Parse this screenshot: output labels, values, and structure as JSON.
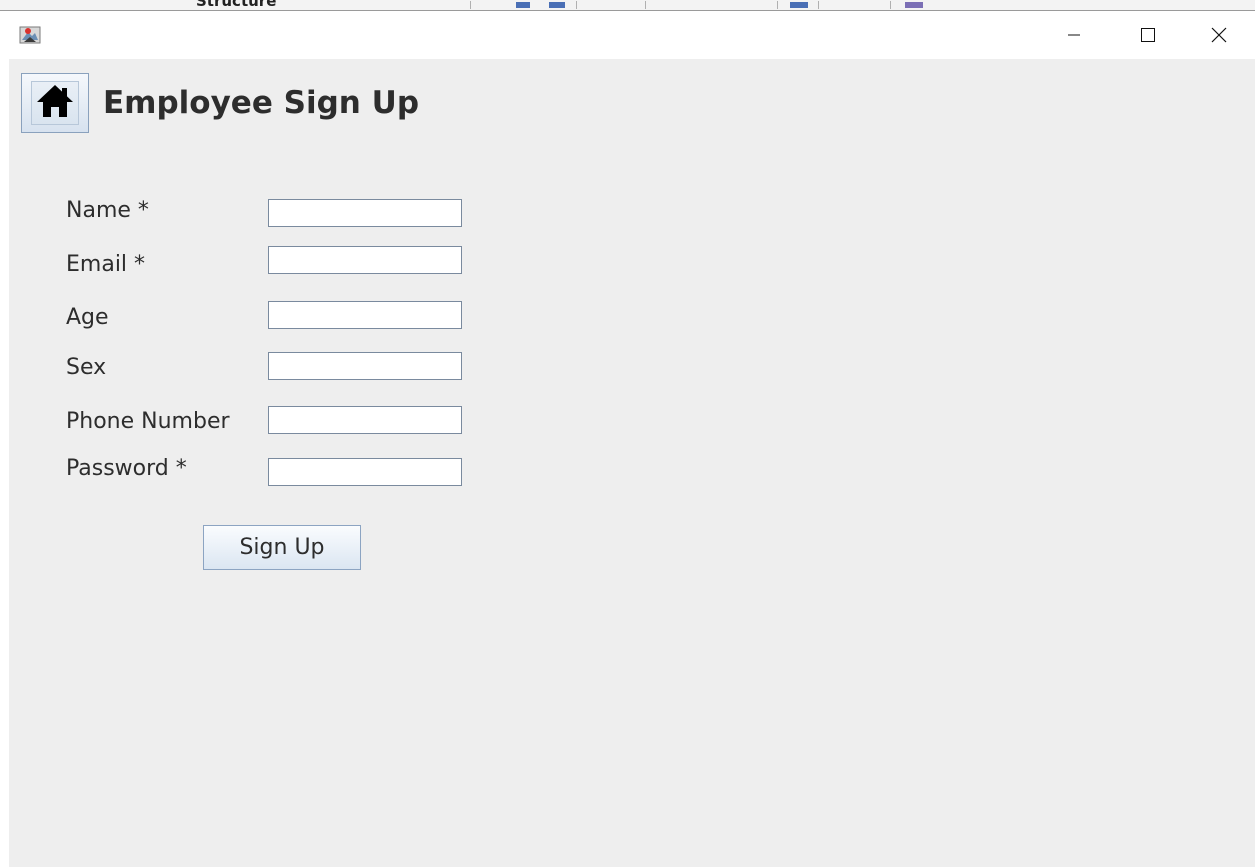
{
  "background_window": {
    "label": "Structure"
  },
  "window": {
    "icon": "java-app-icon",
    "controls": {
      "minimize_icon": "minimize-icon",
      "maximize_icon": "maximize-icon",
      "close_icon": "close-icon"
    }
  },
  "header": {
    "home_icon": "home-icon",
    "title": "Employee Sign Up"
  },
  "form": {
    "fields": [
      {
        "label": "Name *",
        "value": ""
      },
      {
        "label": "Email *",
        "value": ""
      },
      {
        "label": "Age",
        "value": ""
      },
      {
        "label": "Sex",
        "value": ""
      },
      {
        "label": "Phone Number",
        "value": ""
      },
      {
        "label": "Password *",
        "value": ""
      }
    ],
    "submit_label": "Sign Up"
  },
  "colors": {
    "client_background": "#eeeeee",
    "titlebar_background": "#ffffff",
    "text": "#2d2d2d",
    "input_border": "#7a8a9e",
    "button_gradient_top": "#fafcfe",
    "button_gradient_bottom": "#dbe6f2"
  }
}
